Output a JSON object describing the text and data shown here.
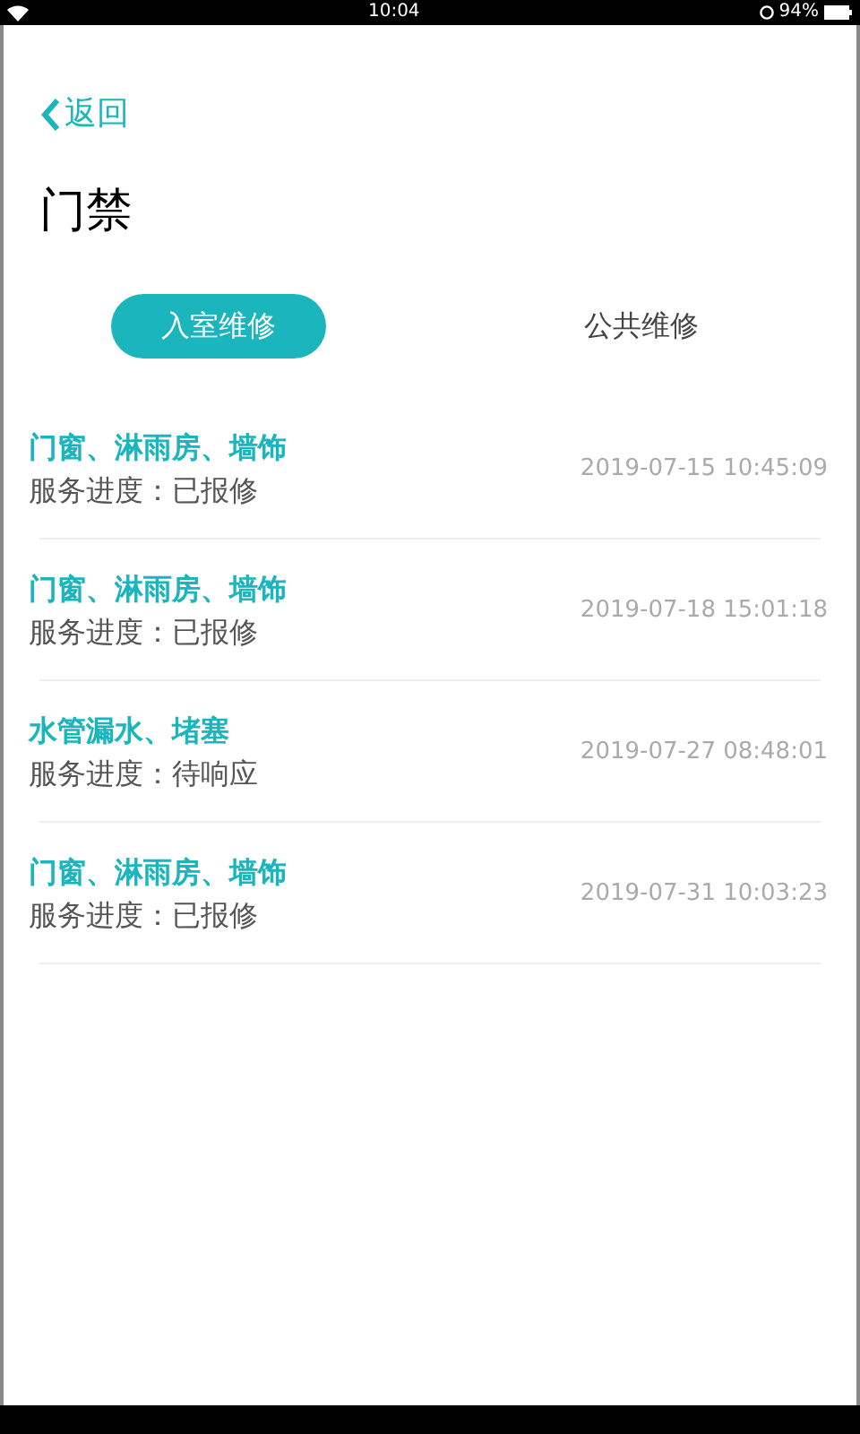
{
  "status_bar": {
    "time": "10:04",
    "battery": "94%"
  },
  "back": {
    "label": "返回"
  },
  "title": "门禁",
  "tabs": [
    {
      "label": "入室维修",
      "selected": true
    },
    {
      "label": "公共维修",
      "selected": false
    }
  ],
  "records": [
    {
      "category": "门窗、淋雨房、墙饰",
      "progress": "服务进度：已报修",
      "time": "2019-07-15 10:45:09"
    },
    {
      "category": "门窗、淋雨房、墙饰",
      "progress": "服务进度：已报修",
      "time": "2019-07-18 15:01:18"
    },
    {
      "category": "水管漏水、堵塞",
      "progress": "服务进度：待响应",
      "time": "2019-07-27 08:48:01"
    },
    {
      "category": "门窗、淋雨房、墙饰",
      "progress": "服务进度：已报修",
      "time": "2019-07-31 10:03:23"
    }
  ]
}
